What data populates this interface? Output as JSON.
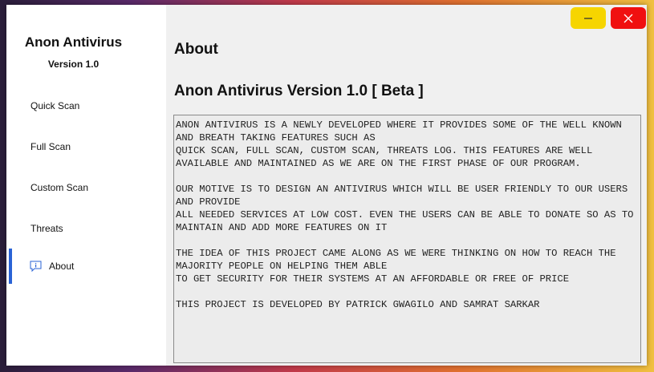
{
  "app": {
    "title": "Anon Antivirus",
    "version": "Version 1.0"
  },
  "nav": {
    "items": [
      {
        "label": "Quick Scan"
      },
      {
        "label": "Full Scan"
      },
      {
        "label": "Custom Scan"
      },
      {
        "label": "Threats"
      },
      {
        "label": "About",
        "icon": "info-icon",
        "active": true
      }
    ]
  },
  "window_controls": {
    "minimize_icon": "minimize-icon",
    "close_icon": "close-icon",
    "minimize_color": "#f6d500",
    "close_color": "#f01010"
  },
  "page": {
    "title": "About",
    "heading": "Anon Antivirus Version 1.0 [ Beta ]",
    "paragraphs": [
      "ANON ANTIVIRUS IS A NEWLY DEVELOPED WHERE IT PROVIDES SOME OF THE WELL KNOWN AND BREATH TAKING FEATURES SUCH AS\nQUICK SCAN, FULL SCAN, CUSTOM SCAN, THREATS LOG. THIS FEATURES ARE WELL AVAILABLE AND MAINTAINED AS WE ARE ON THE FIRST PHASE OF OUR PROGRAM.",
      "OUR MOTIVE IS TO DESIGN AN ANTIVIRUS WHICH WILL BE USER FRIENDLY TO OUR USERS AND PROVIDE\nALL NEEDED SERVICES AT LOW COST. EVEN THE USERS CAN BE ABLE TO DONATE SO AS TO MAINTAIN AND ADD MORE FEATURES ON IT",
      "THE IDEA OF THIS PROJECT CAME ALONG AS WE WERE THINKING ON HOW TO REACH THE MAJORITY PEOPLE ON HELPING THEM ABLE\nTO GET SECURITY FOR THEIR SYSTEMS AT AN AFFORDABLE OR FREE OF PRICE",
      "THIS PROJECT IS DEVELOPED BY PATRICK GWAGILO AND SAMRAT SARKAR"
    ]
  },
  "colors": {
    "accent": "#2a63d6"
  }
}
